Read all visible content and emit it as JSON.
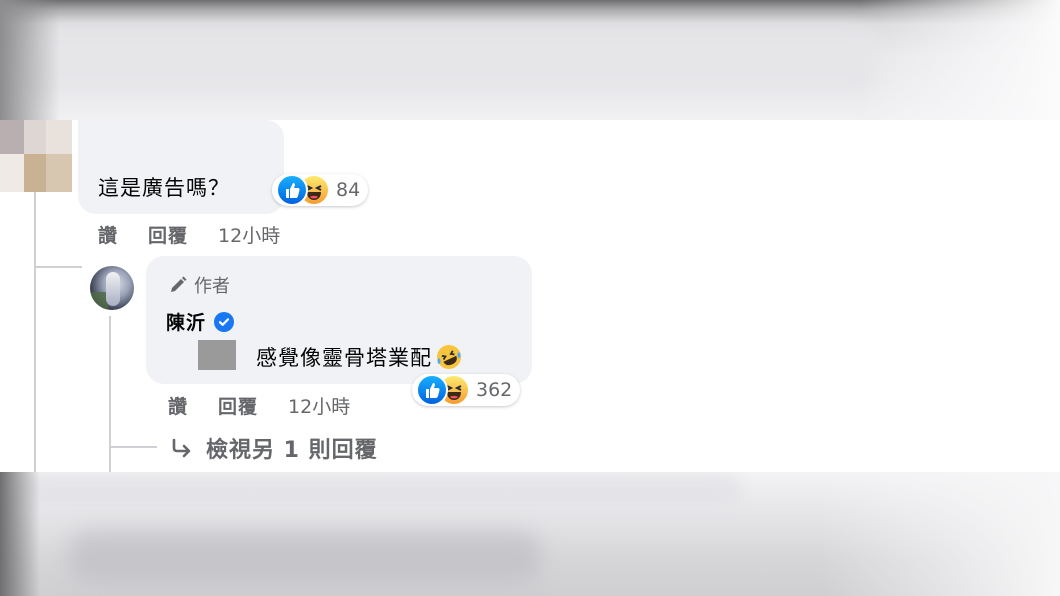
{
  "comments": [
    {
      "text": "這是廣告嗎？",
      "reactions": {
        "types": [
          "like",
          "haha"
        ],
        "count": "84"
      },
      "actions": {
        "like_label": "讚",
        "reply_label": "回覆",
        "time": "12小時"
      }
    }
  ],
  "reply": {
    "author_badge": "作者",
    "author_name": "陳沂",
    "verified": true,
    "text": "感覺像靈骨塔業配",
    "trailing_emoji": "rolling-on-floor-laughing",
    "reactions": {
      "types": [
        "like",
        "haha"
      ],
      "count": "362"
    },
    "actions": {
      "like_label": "讚",
      "reply_label": "回覆",
      "time": "12小時"
    }
  },
  "view_more_replies": "檢視另 1 則回覆",
  "colors": {
    "like": "#1877f2",
    "haha": "#f7b125",
    "bubble": "#f0f2f5",
    "meta_text": "#65676b",
    "thread_line": "#ced0d4"
  }
}
